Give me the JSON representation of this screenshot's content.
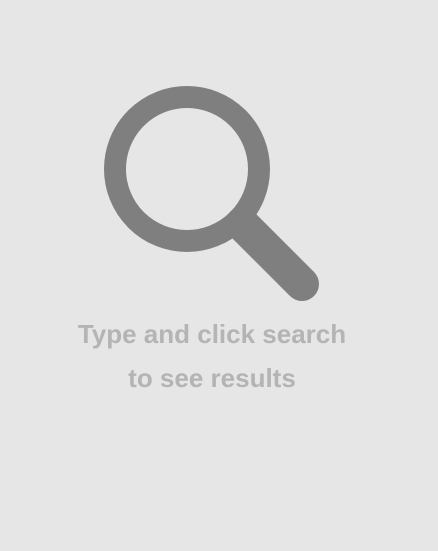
{
  "empty_state": {
    "icon": "search-icon",
    "icon_color": "#7f7f7f",
    "background_color": "#e6e6e6",
    "text_color": "#b4b4b4",
    "message_line1": "Type and click search",
    "message_line2": "to see results"
  }
}
